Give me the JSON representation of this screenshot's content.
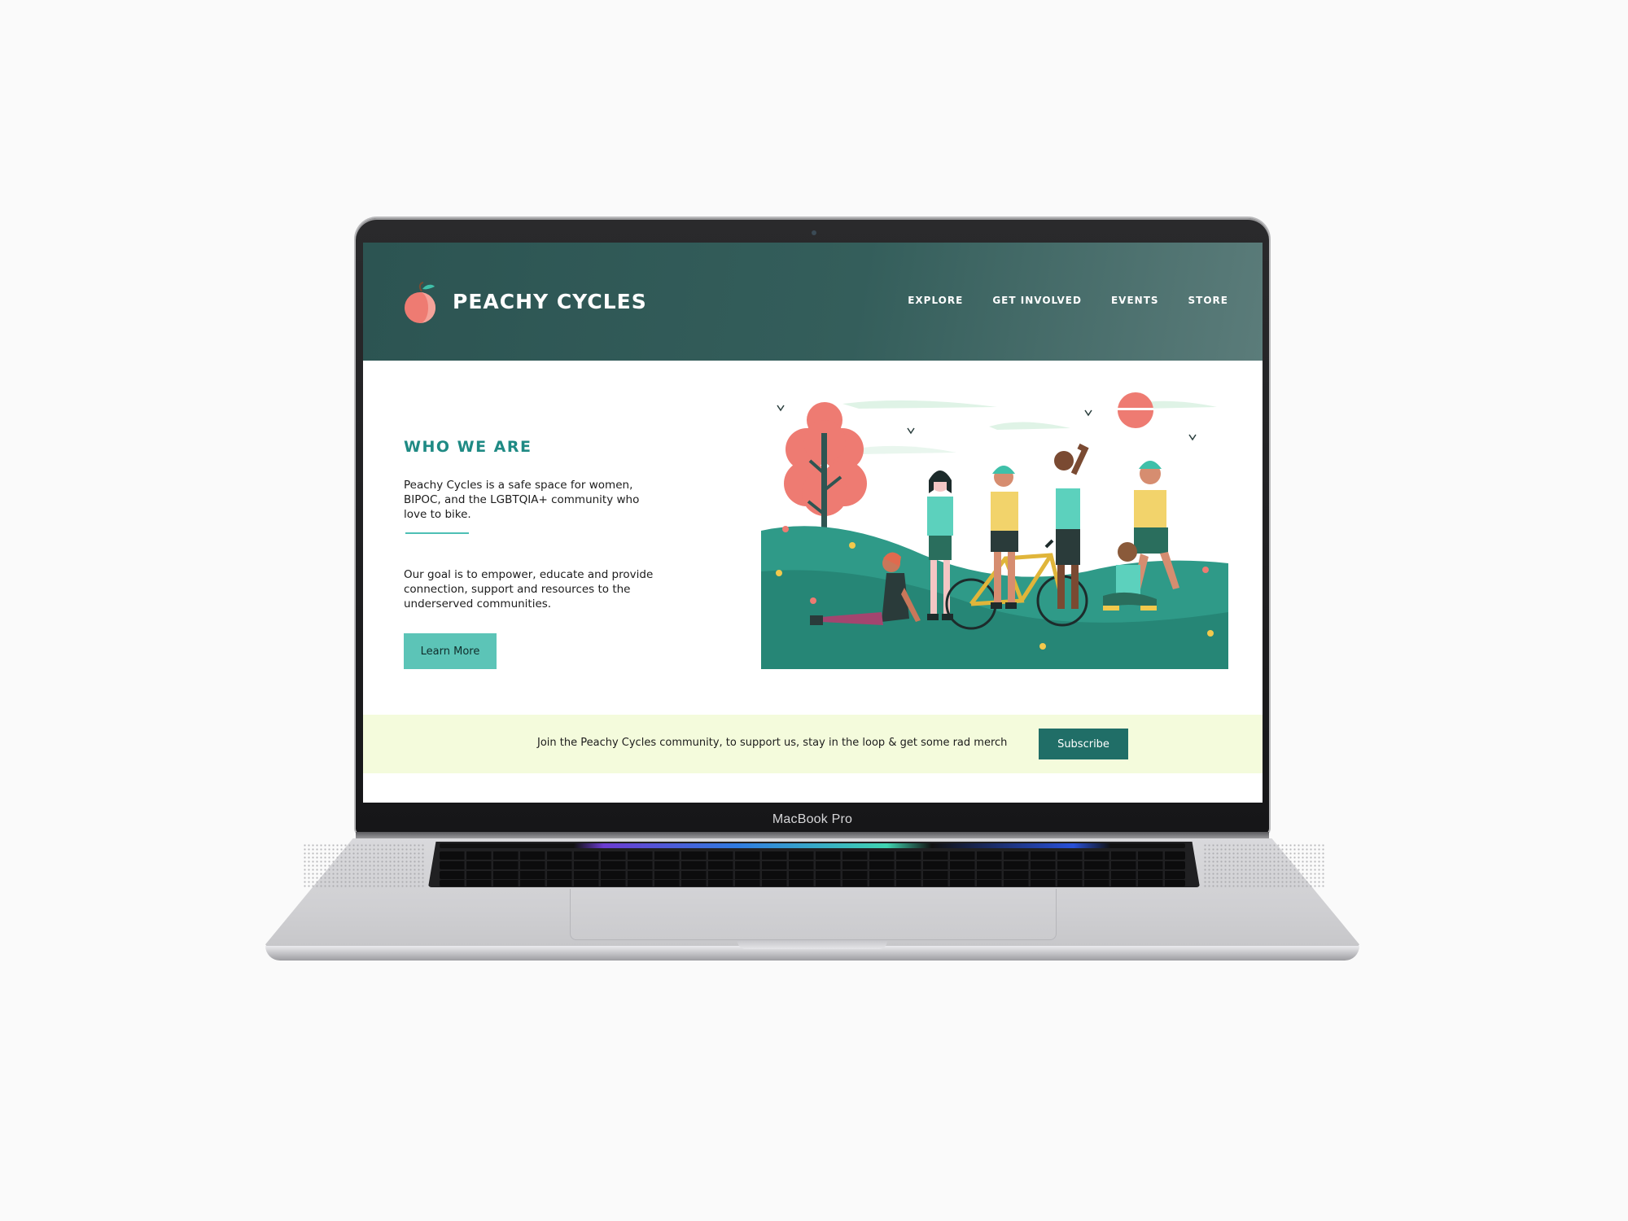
{
  "device": {
    "brand_label": "MacBook Pro"
  },
  "header": {
    "brand": "PEACHY CYCLES",
    "logo_icon": "peach-icon",
    "nav": [
      {
        "label": "EXPLORE"
      },
      {
        "label": "GET INVOLVED"
      },
      {
        "label": "EVENTS"
      },
      {
        "label": "STORE"
      }
    ]
  },
  "about": {
    "heading": "WHO WE ARE",
    "paragraph1": "Peachy Cycles is a safe space for women, BIPOC, and the LGBTQIA+ community who love to bike.",
    "paragraph2": "Our goal is to empower, educate and provide connection, support and resources to the underserved communities.",
    "cta_label": "Learn More"
  },
  "subscribe": {
    "text": "Join the Peachy Cycles community, to support us, stay in the loop & get some rad merch",
    "button_label": "Subscribe"
  },
  "colors": {
    "header_bg": "#2c5452",
    "accent_teal": "#1f8a84",
    "button_teal": "#5cc4b7",
    "subscribe_bg": "#f4fbdc",
    "subscribe_button": "#206e67",
    "peach": "#ee7b72"
  }
}
